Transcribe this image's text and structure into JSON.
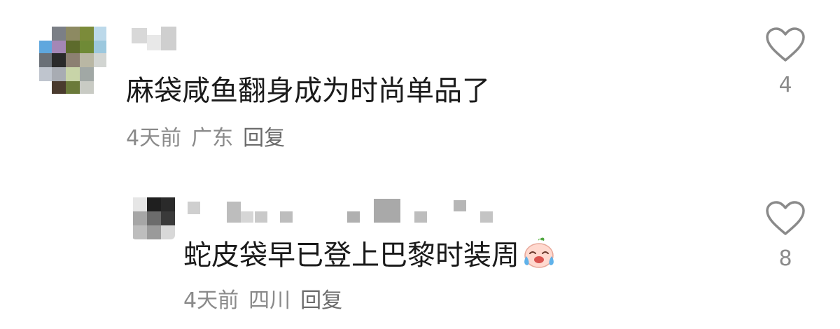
{
  "comments": [
    {
      "text": "麻袋咸鱼翻身成为时尚单品了",
      "time": "4天前",
      "location": "广东",
      "reply_label": "回复",
      "like_count": "4"
    }
  ],
  "replies": [
    {
      "text": "蛇皮袋早已登上巴黎时装周",
      "time": "4天前",
      "location": "四川",
      "reply_label": "回复",
      "like_count": "8",
      "emoji_icon": "crying-laughing-face-icon"
    }
  ],
  "colors": {
    "text": "#1a1a1a",
    "meta": "#8a8a8a",
    "heart_outline": "#8a8a8a"
  }
}
